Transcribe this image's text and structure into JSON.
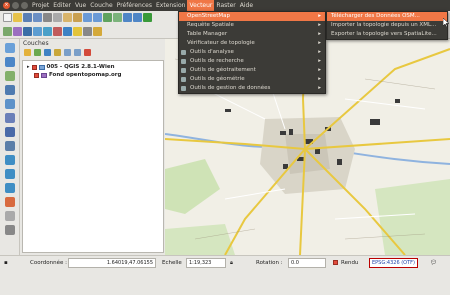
{
  "menubar": {
    "items": [
      "Projet",
      "Editer",
      "Vue",
      "Couche",
      "Préférences",
      "Extension",
      "Vecteur",
      "Raster",
      "Aide"
    ]
  },
  "layers": {
    "title": "Couches",
    "items": [
      {
        "label": "005 - QGIS 2.8.1-Wien"
      },
      {
        "label": "Fond opentopomap.org"
      }
    ]
  },
  "vector_menu": {
    "items": [
      {
        "label": "OpenStreetMap",
        "arrow": "▸"
      },
      {
        "label": "Requête Spatiale",
        "arrow": "▸"
      },
      {
        "label": "Table Manager",
        "arrow": "▸"
      },
      {
        "label": "Vérificateur de topologie",
        "arrow": "▸"
      },
      {
        "label": "Outils d'analyse",
        "arrow": "▸"
      },
      {
        "label": "Outils de recherche",
        "arrow": "▸"
      },
      {
        "label": "Outils de géotraitement",
        "arrow": "▸"
      },
      {
        "label": "Outils de géométrie",
        "arrow": "▸"
      },
      {
        "label": "Outils de gestion de données",
        "arrow": "▸"
      }
    ]
  },
  "osm_submenu": {
    "items": [
      {
        "label": "Télécharger des Données OSM..."
      },
      {
        "label": "Importer la topologie depuis un XML..."
      },
      {
        "label": "Exporter la topologie vers SpatiaLite..."
      }
    ]
  },
  "statusbar": {
    "coord_label": "Coordonnée :",
    "coord_value": "1.64019,47.06155",
    "scale_label": "Echelle",
    "scale_value": "1:19,323",
    "rotation_label": "Rotation :",
    "rotation_value": "0.0",
    "render_label": "Rendu",
    "epsg": "EPSG:4326 (OTF)"
  },
  "colors": {
    "accent": "#f07746",
    "menubar": "#3c3b37"
  }
}
